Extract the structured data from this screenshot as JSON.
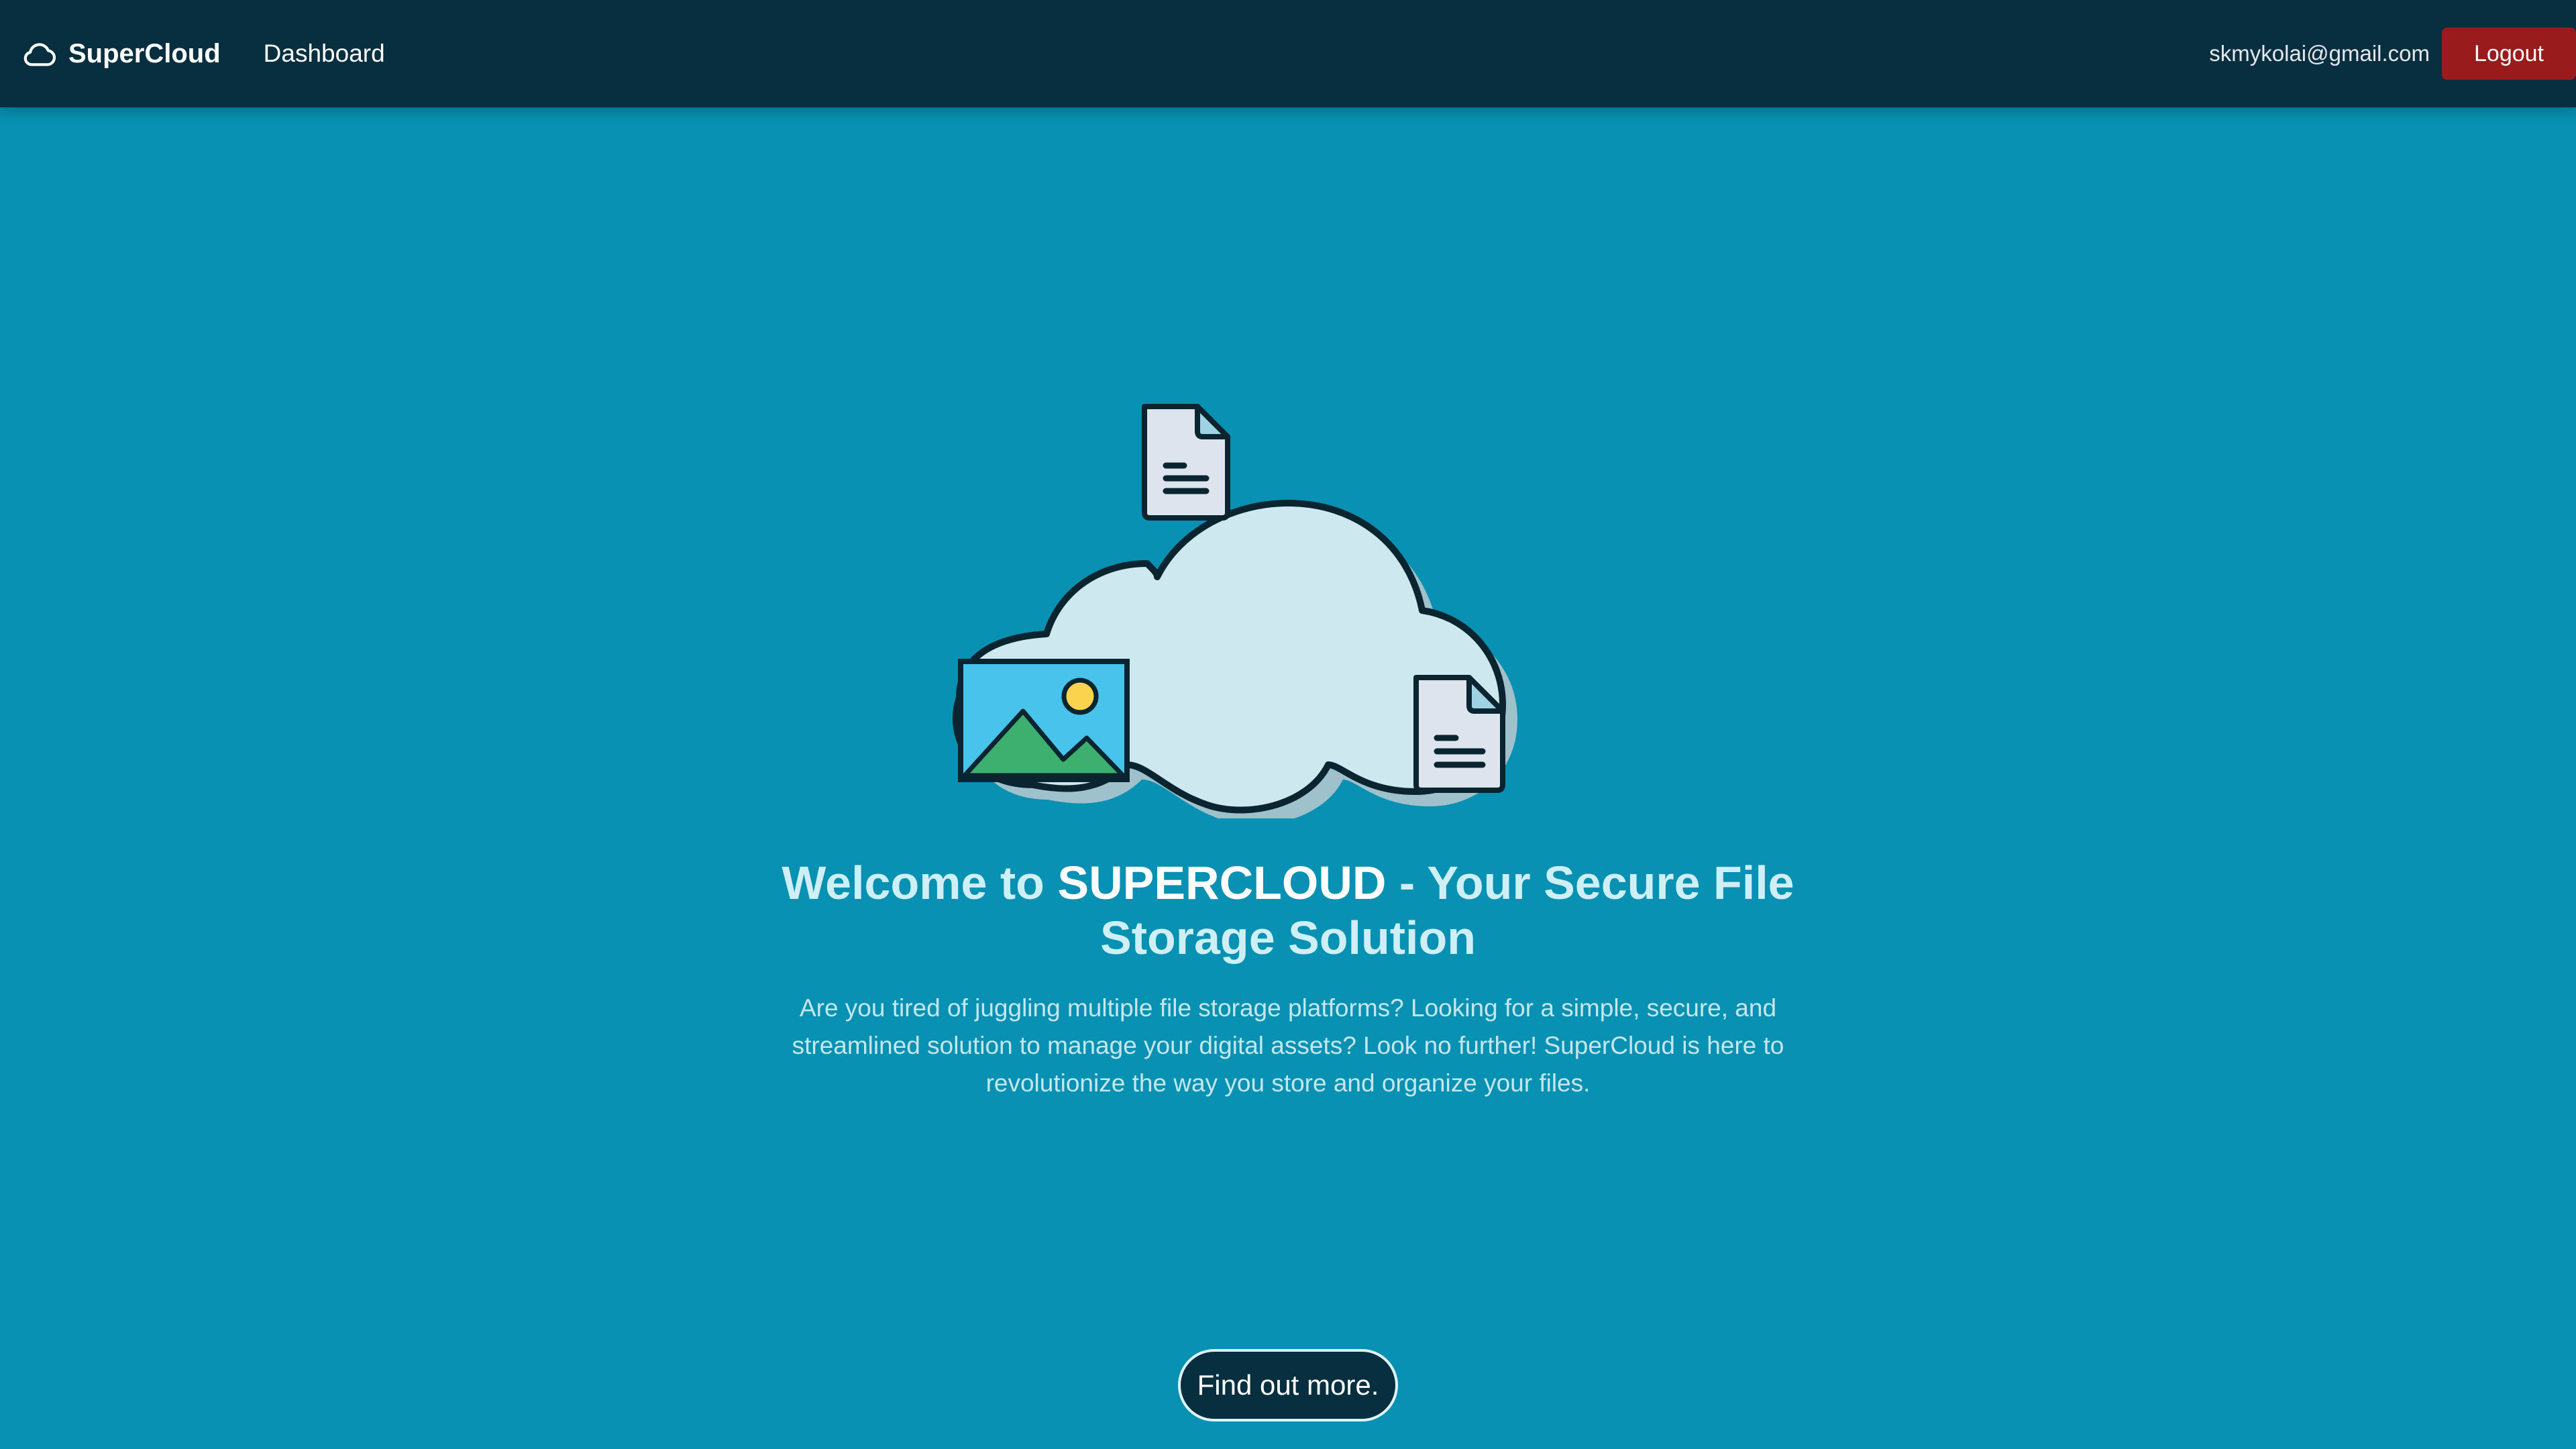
{
  "navbar": {
    "brand_name": "SuperCloud",
    "brand_icon": "cloud-icon",
    "nav_link": "Dashboard",
    "user_email": "skmykolai@gmail.com",
    "logout_label": "Logout"
  },
  "hero": {
    "title_prefix": "Welcome to ",
    "title_brand": "SUPERCLOUD",
    "title_suffix": " - Your Secure File Storage Solution",
    "description": "Are you tired of juggling multiple file storage platforms? Looking for a simple, secure, and streamlined solution to manage your digital assets? Look no further! SuperCloud is here to revolutionize the way you store and organize your files.",
    "cta_label": "Find out more.",
    "illustration_icons": [
      "cloud-illustration",
      "document-icon",
      "image-icon"
    ]
  },
  "colors": {
    "background": "#0891b2",
    "navbar": "#082f40",
    "logout": "#991b1b",
    "title": "#cfeff7"
  }
}
